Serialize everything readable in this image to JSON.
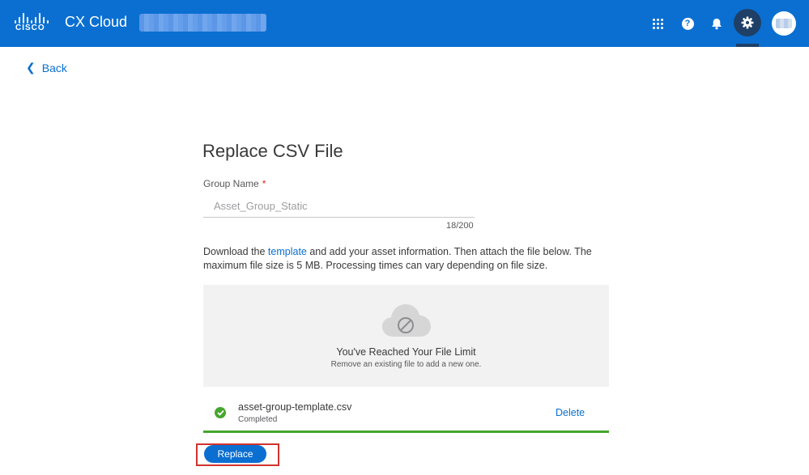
{
  "header": {
    "brand": "CISCO",
    "app_title": "CX Cloud",
    "icons": [
      "apps-grid-icon",
      "help-icon",
      "bell-icon",
      "gear-icon",
      "avatar"
    ],
    "colors": {
      "bar": "#0a6fd1",
      "active_icon_bg": "#1f3f66"
    }
  },
  "nav": {
    "back_label": "Back"
  },
  "form": {
    "title": "Replace CSV File",
    "group_name_label": "Group Name",
    "required_mark": "*",
    "group_name_value": "Asset_Group_Static",
    "char_count": "18/200",
    "instructions_before": "Download the ",
    "template_link": "template",
    "instructions_after": " and add your asset information. Then attach the file below. The maximum file size is 5 MB. Processing times can vary depending on file size."
  },
  "dropzone": {
    "icon": "cloud-blocked-icon",
    "title": "You've Reached Your File Limit",
    "subtitle": "Remove an existing file to add a new one."
  },
  "file": {
    "name": "asset-group-template.csv",
    "status": "Completed",
    "delete_label": "Delete",
    "progress": 1.0,
    "status_color": "#46a62d"
  },
  "actions": {
    "replace_label": "Replace"
  }
}
